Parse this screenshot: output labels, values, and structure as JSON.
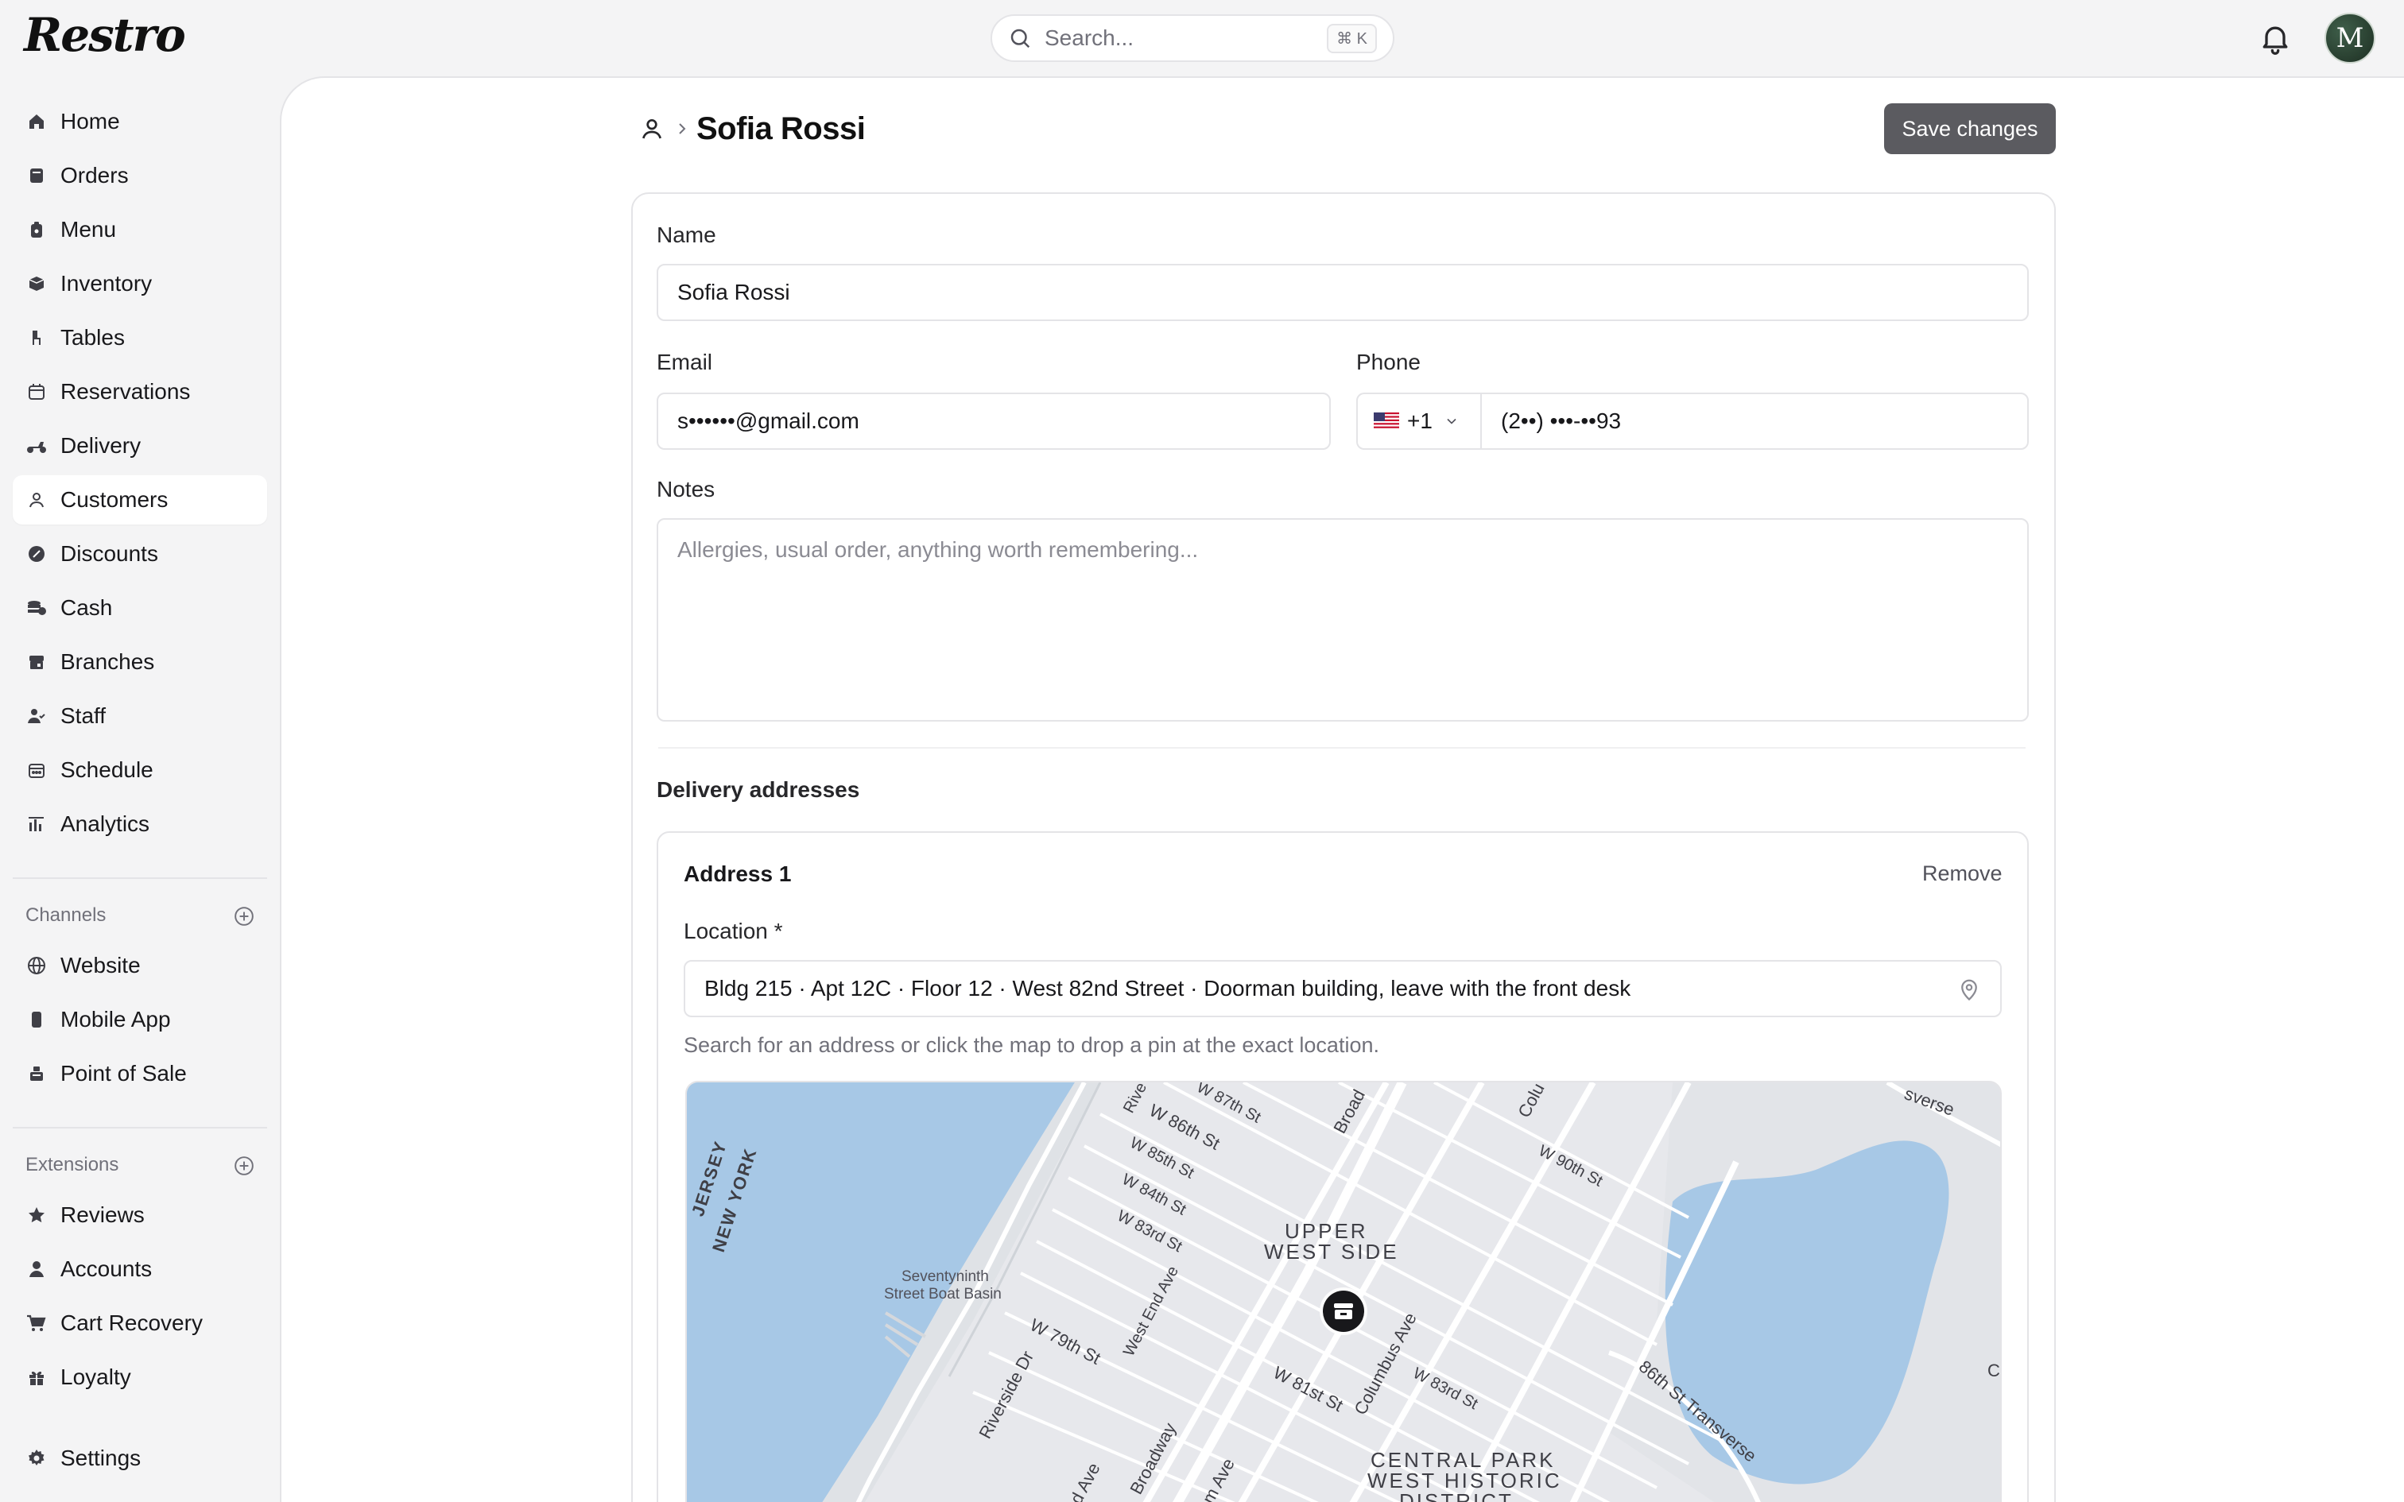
{
  "app": {
    "name": "Restro"
  },
  "search": {
    "placeholder": "Search...",
    "shortcut": "⌘ K"
  },
  "user": {
    "initial": "M"
  },
  "sidebar": {
    "items": [
      {
        "label": "Home",
        "icon": "home-icon"
      },
      {
        "label": "Orders",
        "icon": "orders-icon"
      },
      {
        "label": "Menu",
        "icon": "menu-icon"
      },
      {
        "label": "Inventory",
        "icon": "inventory-icon"
      },
      {
        "label": "Tables",
        "icon": "tables-icon"
      },
      {
        "label": "Reservations",
        "icon": "calendar-icon"
      },
      {
        "label": "Delivery",
        "icon": "scooter-icon"
      },
      {
        "label": "Customers",
        "icon": "user-icon",
        "active": true
      },
      {
        "label": "Discounts",
        "icon": "discount-icon"
      },
      {
        "label": "Cash",
        "icon": "cash-icon"
      },
      {
        "label": "Branches",
        "icon": "store-icon"
      },
      {
        "label": "Staff",
        "icon": "staff-icon"
      },
      {
        "label": "Schedule",
        "icon": "schedule-icon"
      },
      {
        "label": "Analytics",
        "icon": "analytics-icon"
      }
    ],
    "channels_label": "Channels",
    "channels": [
      {
        "label": "Website",
        "icon": "globe-icon"
      },
      {
        "label": "Mobile App",
        "icon": "phone-icon"
      },
      {
        "label": "Point of Sale",
        "icon": "pos-icon"
      }
    ],
    "extensions_label": "Extensions",
    "extensions": [
      {
        "label": "Reviews",
        "icon": "star-icon"
      },
      {
        "label": "Accounts",
        "icon": "account-icon"
      },
      {
        "label": "Cart Recovery",
        "icon": "cart-icon"
      },
      {
        "label": "Loyalty",
        "icon": "gift-icon"
      }
    ],
    "settings_label": "Settings"
  },
  "page": {
    "title": "Sofia Rossi",
    "save_label": "Save changes"
  },
  "form": {
    "name_label": "Name",
    "name_value": "Sofia Rossi",
    "email_label": "Email",
    "email_value": "s••••••@gmail.com",
    "phone_label": "Phone",
    "phone_country_code": "+1",
    "phone_value": "(2••) •••-••93",
    "notes_label": "Notes",
    "notes_placeholder": "Allergies, usual order, anything worth remembering..."
  },
  "delivery": {
    "heading": "Delivery addresses",
    "address_title": "Address 1",
    "remove_label": "Remove",
    "location_label": "Location *",
    "location_value": "Bldg 215 · Apt 12C · Floor 12 · West 82nd Street · Doorman building, leave with the front desk",
    "help_text": "Search for an address or click the map to drop a pin at the exact location."
  },
  "map": {
    "labels": {
      "nj_ny_1": "JERSEY",
      "nj_ny_2": "NEW YORK",
      "boat_basin_1": "Seventyninth",
      "boat_basin_2": "Street Boat Basin",
      "uws_1": "UPPER",
      "uws_2": "WEST SIDE",
      "cp_1": "CENTRAL PARK",
      "cp_2": "WEST HISTORIC",
      "cp_3": "DISTRICT",
      "w86": "W 86th St",
      "w85": "W 85th St",
      "w84": "W 84th St",
      "w83": "W 83rd St",
      "w79": "W 79th St",
      "w81": "W 81st St",
      "w83e": "W 83rd St",
      "w90": "W 90th St",
      "w87": "W 87th St",
      "broadway": "Broadway",
      "broad_top": "Broad",
      "col_top": "Colu",
      "columbus": "Columbus Ave",
      "west_end": "West End Ave",
      "west_end_b": "End Ave",
      "riverside": "Riverside Dr",
      "amsterdam": "rdam Ave",
      "transverse": "86th St Transverse",
      "rive_top": "Rive",
      "sverse": "sverse",
      "c_right": "C"
    }
  }
}
